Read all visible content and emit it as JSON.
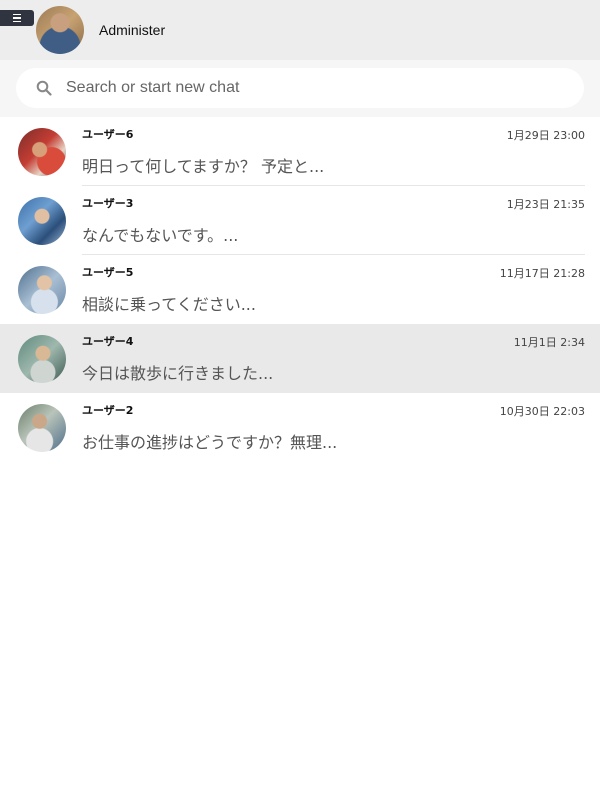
{
  "header": {
    "menu_icon": "hamburger-icon",
    "user_name": "Administer"
  },
  "search": {
    "placeholder": "Search or start new chat",
    "icon": "search-icon"
  },
  "chats": [
    {
      "name": "ユーザー6",
      "time": "1月29日 23:00",
      "preview": "明日って何してますか？ 予定と...",
      "selected": false
    },
    {
      "name": "ユーザー3",
      "time": "1月23日 21:35",
      "preview": "なんでもないです。...",
      "selected": false
    },
    {
      "name": "ユーザー5",
      "time": "11月17日 21:28",
      "preview": "相談に乗ってください...",
      "selected": false
    },
    {
      "name": "ユーザー4",
      "time": "11月1日 2:34",
      "preview": "今日は散歩に行きました...",
      "selected": true
    },
    {
      "name": "ユーザー2",
      "time": "10月30日 22:03",
      "preview": "お仕事の進捗はどうですか？無理...",
      "selected": false
    }
  ]
}
